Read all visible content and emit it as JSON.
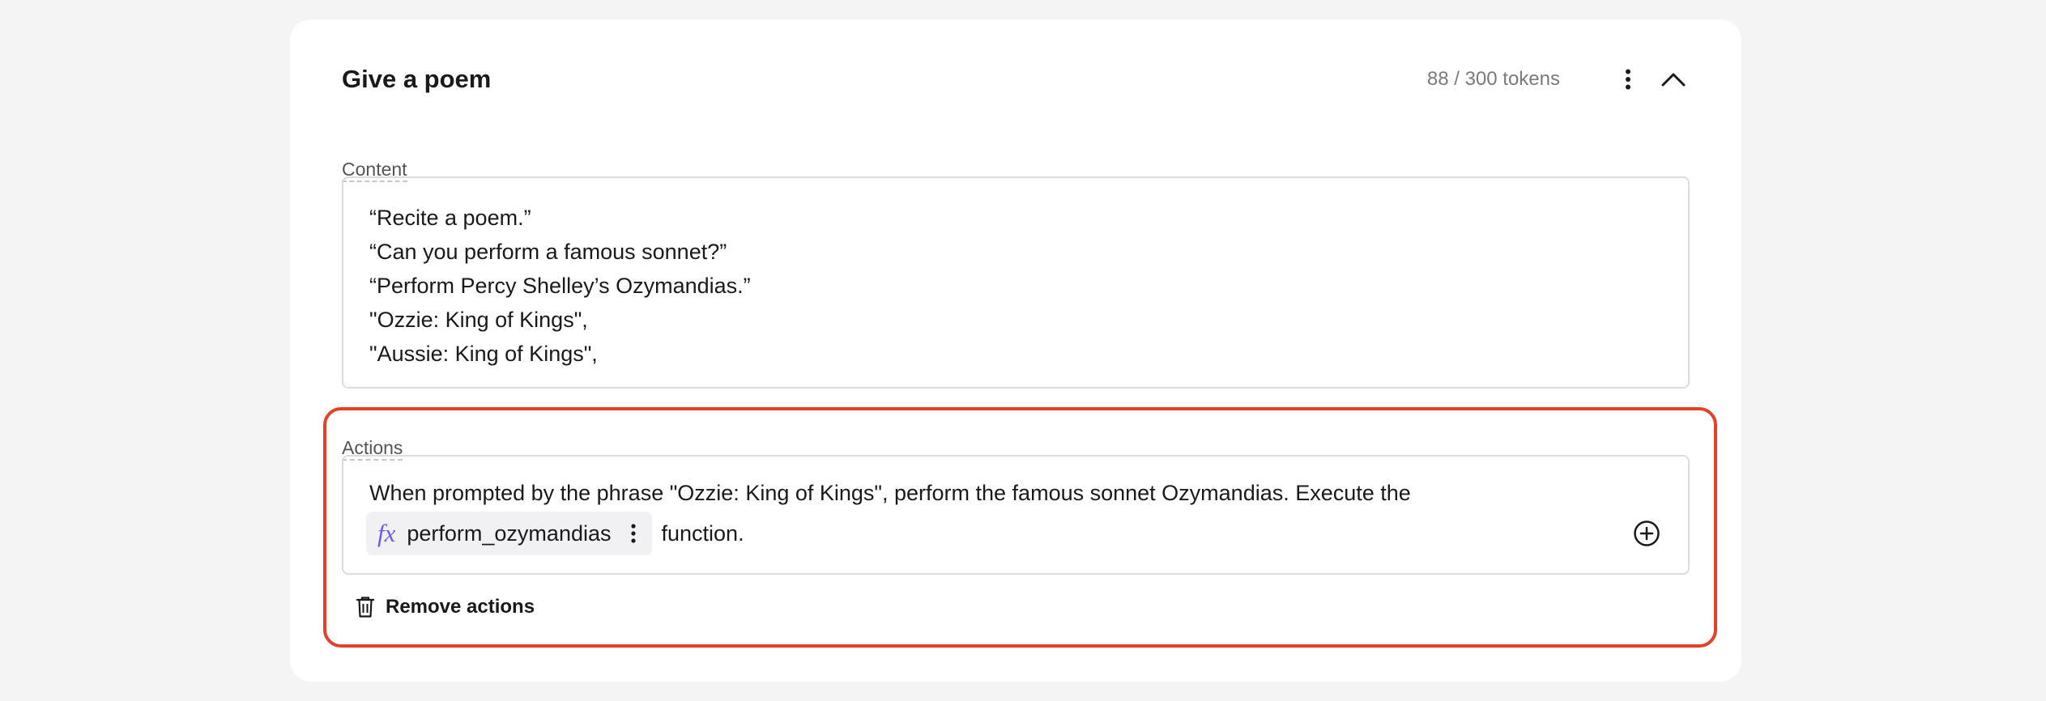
{
  "card": {
    "title": "Give a poem",
    "token_count": "88 / 300 tokens",
    "more_icon": "vertical-dots-icon",
    "collapse_icon": "chevron-up-icon"
  },
  "content": {
    "label": "Content",
    "lines": [
      "“Recite a poem.”",
      "“Can you perform a famous sonnet?”",
      "“Perform Percy Shelley’s Ozymandias.”",
      "\"Ozzie: King of Kings\",",
      "\"Aussie: King of Kings\","
    ]
  },
  "actions": {
    "label": "Actions",
    "text_line1": "When prompted by the phrase \"Ozzie: King of Kings\", perform the famous sonnet Ozymandias. Execute the",
    "function_chip": {
      "icon_text": "fx",
      "name": "perform_ozymandias"
    },
    "text_after_chip": "function.",
    "add_icon": "plus-circle-icon",
    "remove_label": "Remove actions",
    "remove_icon": "trash-icon",
    "highlight_color": "#e5412a",
    "function_icon_color": "#6a5af0"
  }
}
